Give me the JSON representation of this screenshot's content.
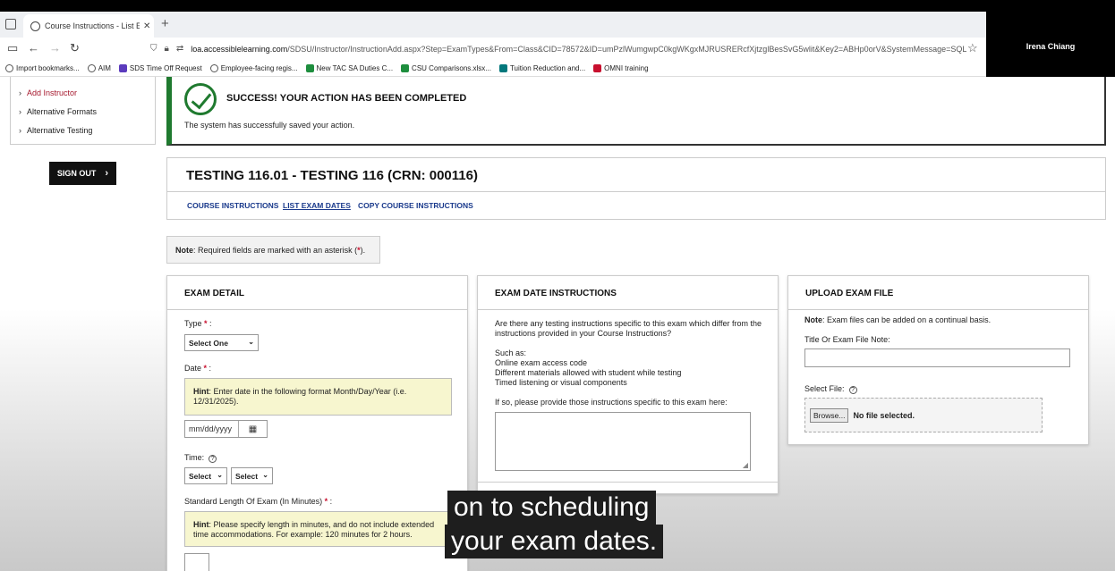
{
  "browser": {
    "tab_title": "Course Instructions - List Exam",
    "tab_close": "✕",
    "new_tab": "+",
    "url_host": "loa.accessiblelearning.com",
    "url_path": "/SDSU/Instructor/InstructionAdd.aspx?Step=ExamTypes&From=Class&CID=78572&ID=umPzlWumgwpC0kgWKgxMJRUSRERcfXjtzglBesSvG5wlit&Key2=ABHp0orV&SystemMessage=SQL",
    "bookmarks": [
      {
        "label": "Import bookmarks...",
        "icon": "import-icon",
        "color": "#555555"
      },
      {
        "label": "AIM",
        "icon": "globe-icon",
        "color": "#555555"
      },
      {
        "label": "SDS Time Off Request",
        "icon": "form-icon",
        "color": "#5b3bbd"
      },
      {
        "label": "Employee-facing regis...",
        "icon": "globe-icon",
        "color": "#555555"
      },
      {
        "label": "New TAC SA Duties C...",
        "icon": "sheet-icon",
        "color": "#1e8e3e"
      },
      {
        "label": "CSU Comparisons.xlsx...",
        "icon": "sheet-icon",
        "color": "#1e8e3e"
      },
      {
        "label": "Tuition Reduction and...",
        "icon": "sharepoint-icon",
        "color": "#03787c"
      },
      {
        "label": "OMNI training",
        "icon": "sd-icon",
        "color": "#c8102e"
      }
    ]
  },
  "participant": {
    "name": "Irena Chiang"
  },
  "sidebar": {
    "items": [
      {
        "label": "Add Instructor",
        "active": true
      },
      {
        "label": "Alternative Formats",
        "active": false
      },
      {
        "label": "Alternative Testing",
        "active": false
      }
    ],
    "sign_out": "SIGN OUT"
  },
  "success": {
    "title": "SUCCESS! YOUR ACTION HAS BEEN COMPLETED",
    "message": "The system has successfully saved your action."
  },
  "course": {
    "title": "TESTING 116.01 - TESTING 116 (CRN: 000116)",
    "links": [
      "COURSE INSTRUCTIONS",
      "LIST EXAM DATES",
      "COPY COURSE INSTRUCTIONS"
    ]
  },
  "note": {
    "bold": "Note",
    "text": ": Required fields are marked with an asterisk (",
    "asterisk": "*",
    "close": ")."
  },
  "exam_detail": {
    "header": "EXAM DETAIL",
    "type_label": "Type",
    "type_value": "Select One",
    "date_label": "Date",
    "date_hint_bold": "Hint",
    "date_hint": ": Enter date in the following format Month/Day/Year (i.e. 12/31/2025).",
    "date_placeholder": "mm/dd/yyyy",
    "time_label": "Time:",
    "time_hour": "Select",
    "time_minute": "Select",
    "length_label": "Standard Length Of Exam (In Minutes)",
    "length_hint_bold": "Hint",
    "length_hint": ": Please specify length in minutes, and do not include extended time accommodations. For example: 120 minutes for 2 hours."
  },
  "exam_instructions": {
    "header": "EXAM DATE INSTRUCTIONS",
    "question": "Are there any testing instructions specific to this exam which differ from the instructions provided in your Course Instructions?",
    "such_as": "Such as:",
    "examples": [
      "Online exam access code",
      "Different materials allowed with student while testing",
      "Timed listening or visual components"
    ],
    "prompt": "If so, please provide those instructions specific to this exam here:"
  },
  "upload": {
    "header": "UPLOAD EXAM FILE",
    "note_bold": "Note",
    "note": ": Exam files can be added on a continual basis.",
    "title_label": "Title Or Exam File Note:",
    "select_label": "Select File:",
    "browse": "Browse...",
    "no_file": "No file selected."
  },
  "caption": {
    "line1": "on to scheduling",
    "line2": "your exam dates."
  }
}
